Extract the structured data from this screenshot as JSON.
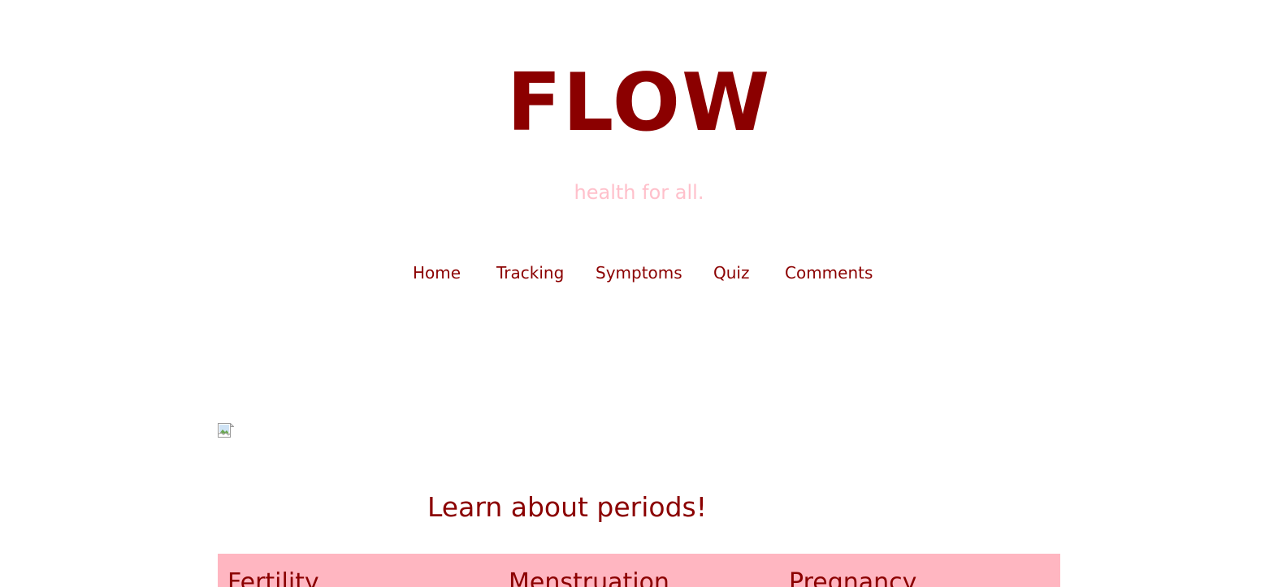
{
  "header": {
    "title": "FLOW",
    "tagline": "health for all."
  },
  "nav": {
    "items": [
      {
        "label": "Home"
      },
      {
        "label": "Tracking"
      },
      {
        "label": "Symptoms"
      },
      {
        "label": "Quiz"
      },
      {
        "label": "Comments"
      }
    ]
  },
  "main": {
    "heading": "Learn about periods!",
    "topics": [
      {
        "label": "Fertility"
      },
      {
        "label": "Menstruation"
      },
      {
        "label": "Pregnancy"
      }
    ]
  },
  "colors": {
    "brand": "#8b0000",
    "tagline": "#ffc0cb",
    "topic_bar": "#ffb6c1",
    "background": "#ffffff"
  },
  "icons": {
    "broken_image": "broken-image-icon"
  }
}
